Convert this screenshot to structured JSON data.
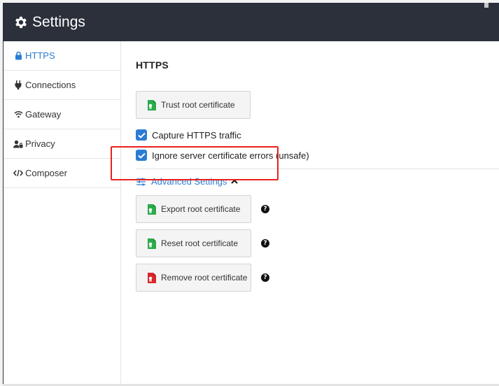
{
  "window": {
    "title": "Settings"
  },
  "sidebar": {
    "items": [
      {
        "label": "HTTPS",
        "icon": "lock-icon",
        "active": true
      },
      {
        "label": "Connections",
        "icon": "plug-icon",
        "active": false
      },
      {
        "label": "Gateway",
        "icon": "wifi-icon",
        "active": false
      },
      {
        "label": "Privacy",
        "icon": "user-lock-icon",
        "active": false
      },
      {
        "label": "Composer",
        "icon": "code-icon",
        "active": false
      }
    ]
  },
  "main": {
    "heading": "HTTPS",
    "trust_button": "Trust root certificate",
    "checkboxes": [
      {
        "label": "Capture HTTPS traffic",
        "checked": true
      },
      {
        "label": "Ignore server certificate errors (unsafe)",
        "checked": true
      }
    ],
    "advanced_label": "Advanced Settings",
    "advanced_buttons": [
      {
        "label": "Export root certificate",
        "icon_color": "#2bab4a"
      },
      {
        "label": "Reset root certificate",
        "icon_color": "#2bab4a"
      },
      {
        "label": "Remove root certificate",
        "icon_color": "#d9262c"
      }
    ],
    "help_glyph": "?"
  },
  "colors": {
    "titlebar": "#2b303b",
    "accent": "#2b7cd3",
    "cert_green": "#2bab4a",
    "cert_red": "#d9262c",
    "highlight": "#e8211f"
  }
}
